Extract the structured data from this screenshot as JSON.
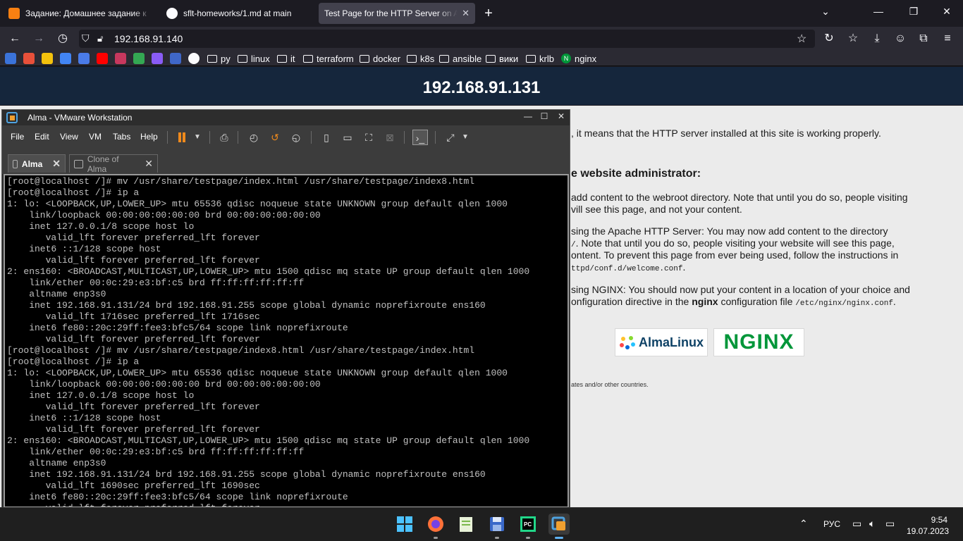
{
  "browser": {
    "tabs": [
      {
        "title": "Задание: Домашнее задание к",
        "close": "✕",
        "icon": "moodle-icon",
        "color": "#f98012"
      },
      {
        "title": "sflt-homeworks/1.md at main",
        "close": "✕",
        "icon": "github-icon",
        "color": "#fbfbfe"
      },
      {
        "title": "Test Page for the HTTP Server on Al",
        "close": "✕",
        "icon": "none"
      }
    ],
    "new_tab": "+",
    "url": "192.168.91.140",
    "bookmarks": [
      {
        "label": "py",
        "type": "folder"
      },
      {
        "label": "linux",
        "type": "folder"
      },
      {
        "label": "it",
        "type": "folder"
      },
      {
        "label": "terraform",
        "type": "folder"
      },
      {
        "label": "docker",
        "type": "folder"
      },
      {
        "label": "k8s",
        "type": "folder"
      },
      {
        "label": "ansible",
        "type": "folder"
      },
      {
        "label": "вики",
        "type": "folder"
      },
      {
        "label": "krlb",
        "type": "folder"
      },
      {
        "label": "nginx",
        "type": "link",
        "icon": "nginx-icon"
      }
    ]
  },
  "webpage": {
    "heading": "192.168.91.131",
    "line_working": ", it means that the HTTP server installed at this site is working properly.",
    "admin_heading": "e website administrator:",
    "p1_l1": "add content to the webroot directory. Note that until you do so, people visiting",
    "p1_l2": "vill see this page, and not your content.",
    "p2_l1": "sing the Apache HTTP Server: You may now add content to the directory",
    "p2_l2_mono": "/",
    "p2_l2": ". Note that until you do so, people visiting your website will see this page,",
    "p2_l3": "ontent. To prevent this page from ever being used, follow the instructions in",
    "p2_l4_mono": "ttpd/conf.d/welcome.conf",
    "p2_l4_end": ".",
    "p3_l1": "sing NGINX: You should now put your content in a location of your choice and",
    "p3_l2_a": "onfiguration directive in the ",
    "p3_l2_b": "nginx",
    "p3_l2_c": " configuration file ",
    "p3_l2_mono": "/etc/nginx/nginx.conf",
    "p3_l2_end": ".",
    "logo_alma": "AlmaLinux",
    "logo_nginx": "NGINX",
    "footer": "ates and/or other countries."
  },
  "vmware": {
    "title": "Alma - VMware Workstation",
    "menu": [
      "File",
      "Edit",
      "View",
      "VM",
      "Tabs",
      "Help"
    ],
    "tabs": [
      {
        "label": "Alma",
        "close": "✕"
      },
      {
        "label": "Clone of Alma",
        "close": "✕"
      }
    ],
    "console_lines": [
      "[root@localhost /]# mv /usr/share/testpage/index.html /usr/share/testpage/index8.html",
      "[root@localhost /]# ip a",
      "1: lo: <LOOPBACK,UP,LOWER_UP> mtu 65536 qdisc noqueue state UNKNOWN group default qlen 1000",
      "    link/loopback 00:00:00:00:00:00 brd 00:00:00:00:00:00",
      "    inet 127.0.0.1/8 scope host lo",
      "       valid_lft forever preferred_lft forever",
      "    inet6 ::1/128 scope host",
      "       valid_lft forever preferred_lft forever",
      "2: ens160: <BROADCAST,MULTICAST,UP,LOWER_UP> mtu 1500 qdisc mq state UP group default qlen 1000",
      "    link/ether 00:0c:29:e3:bf:c5 brd ff:ff:ff:ff:ff:ff",
      "    altname enp3s0",
      "    inet 192.168.91.131/24 brd 192.168.91.255 scope global dynamic noprefixroute ens160",
      "       valid_lft 1716sec preferred_lft 1716sec",
      "    inet6 fe80::20c:29ff:fee3:bfc5/64 scope link noprefixroute",
      "       valid_lft forever preferred_lft forever",
      "[root@localhost /]# mv /usr/share/testpage/index8.html /usr/share/testpage/index.html",
      "[root@localhost /]# ip a",
      "1: lo: <LOOPBACK,UP,LOWER_UP> mtu 65536 qdisc noqueue state UNKNOWN group default qlen 1000",
      "    link/loopback 00:00:00:00:00:00 brd 00:00:00:00:00:00",
      "    inet 127.0.0.1/8 scope host lo",
      "       valid_lft forever preferred_lft forever",
      "    inet6 ::1/128 scope host",
      "       valid_lft forever preferred_lft forever",
      "2: ens160: <BROADCAST,MULTICAST,UP,LOWER_UP> mtu 1500 qdisc mq state UP group default qlen 1000",
      "    link/ether 00:0c:29:e3:bf:c5 brd ff:ff:ff:ff:ff:ff",
      "    altname enp3s0",
      "    inet 192.168.91.131/24 brd 192.168.91.255 scope global dynamic noprefixroute ens160",
      "       valid_lft 1690sec preferred_lft 1690sec",
      "    inet6 fe80::20c:29ff:fee3:bfc5/64 scope link noprefixroute",
      "       valid_lft forever preferred_lft forever"
    ]
  },
  "taskbar": {
    "lang": "РУС",
    "time": "9:54",
    "date": "19.07.2023"
  },
  "colors": {
    "page_header": "#15263c",
    "page_body": "#ebebeb",
    "vmware_pause": "#f08a1c",
    "nginx_green": "#009639",
    "alma_blue": "#0f4266"
  }
}
